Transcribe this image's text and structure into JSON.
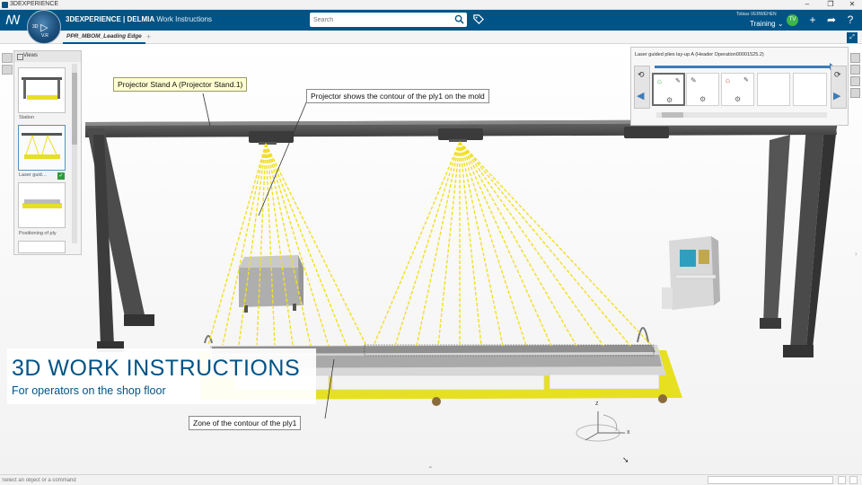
{
  "window": {
    "title": "3DEXPERIENCE",
    "controls": [
      "–",
      "❐",
      "✕"
    ]
  },
  "app": {
    "brand_bold": "3DEXPERIENCE | DELMIA",
    "brand_sub": "Work Instructions",
    "compass_version": "V.R",
    "compass_num": "3D"
  },
  "search": {
    "placeholder": "Search"
  },
  "user": {
    "name": "Tobias VERWEHEN",
    "role": "Training ⌄",
    "initials": "TV"
  },
  "tabs": [
    {
      "label": "PPR_MBOM_Leading Edge"
    }
  ],
  "views_panel": {
    "header": "Views",
    "items": [
      {
        "label": "Station"
      },
      {
        "label": "Laser guid…"
      },
      {
        "label": "Positioning of ply"
      }
    ]
  },
  "callouts": {
    "stand": "Projector Stand A (Projector Stand.1)",
    "projector": "Projector shows the contour of the ply1 on the mold",
    "zone": "Zone of the contour of the ply1"
  },
  "steps_panel": {
    "title": "Laser guided plies lay-up  A (Header Operation00001525.2)",
    "steps": [
      {
        "icon": "home-green-icon",
        "selected": true
      },
      {
        "icon": "edit-icon",
        "selected": false
      },
      {
        "icon": "home-red-icon",
        "selected": false
      },
      {
        "icon": "edit-icon",
        "selected": false
      },
      {
        "icon": "blank",
        "selected": false
      },
      {
        "icon": "blank",
        "selected": false
      },
      {
        "icon": "blank",
        "selected": false
      }
    ]
  },
  "banner": {
    "title": "3D WORK INSTRUCTIONS",
    "subtitle": "For operators on the shop floor"
  },
  "axes": {
    "x": "x",
    "z": "z"
  },
  "status": {
    "placeholder": "Select an object or a command"
  },
  "colors": {
    "brand": "#005386",
    "laser": "#f2e22a",
    "mold": "#e9e21a"
  }
}
